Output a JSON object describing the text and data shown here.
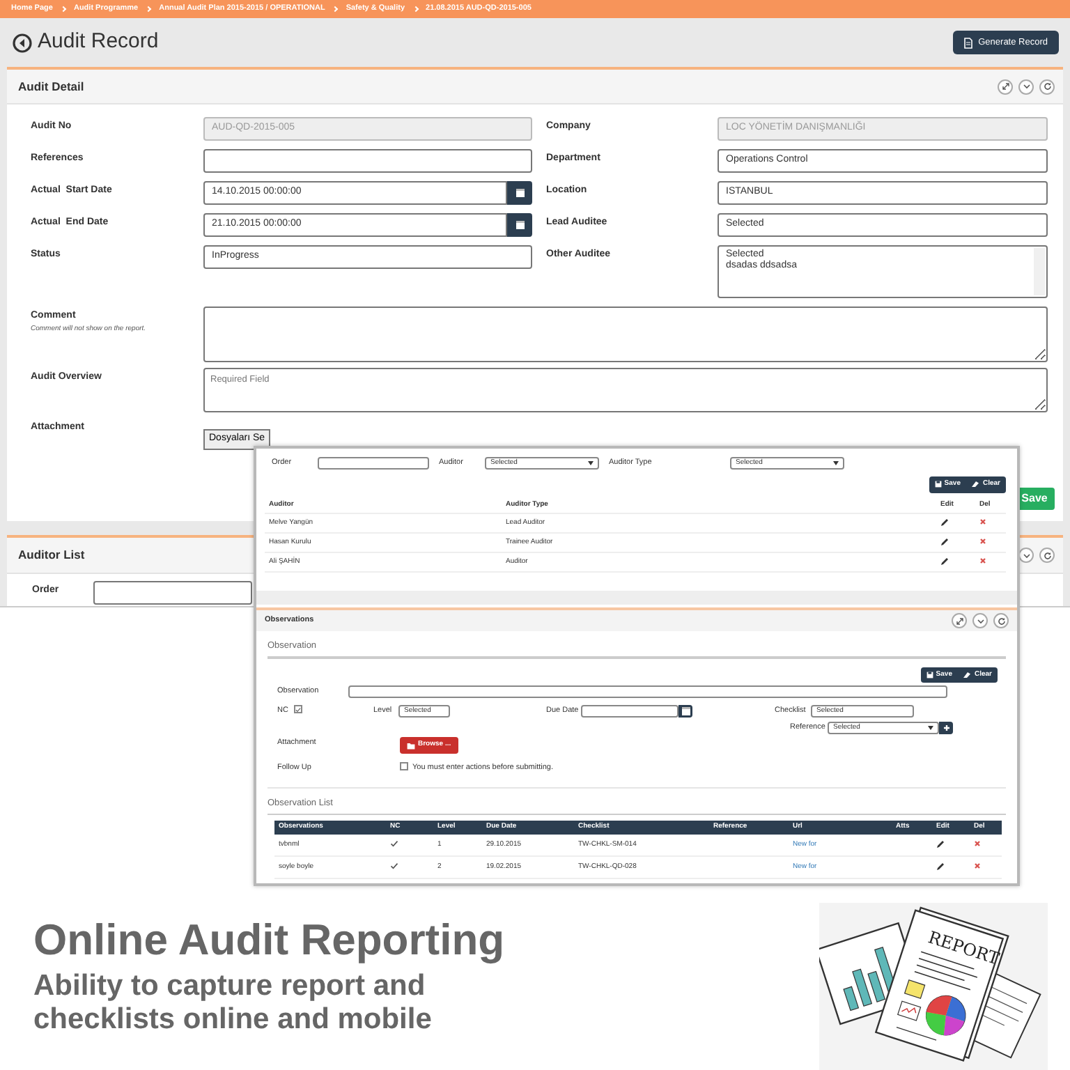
{
  "breadcrumb": [
    "Home Page",
    "Audit Programme",
    "Annual Audit Plan 2015-2015 / OPERATIONAL",
    "Safety & Quality",
    "21.08.2015 AUD-QD-2015-005"
  ],
  "header": {
    "title": "Audit Record",
    "button": "Generate Record"
  },
  "audit_detail": {
    "title": "Audit Detail",
    "rows": [
      [
        {
          "label": "Audit No",
          "kind": "text",
          "value": "AUD-QD-2015-005",
          "disabled": true
        },
        {
          "label": "Company",
          "kind": "text",
          "value": "LOC YÖNETİM DANIŞMANLIĞI",
          "disabled": true
        }
      ],
      [
        {
          "label": "References",
          "kind": "text",
          "disabled": false
        },
        {
          "label": "Department",
          "kind": "text",
          "value": "Operations Control",
          "disabled": false
        }
      ],
      [
        {
          "label": "Actual  Start Date",
          "kind": "date",
          "value": "14.10.2015 00:00:00",
          "disabled": false
        },
        {
          "label": "Location",
          "kind": "text",
          "value": "ISTANBUL",
          "disabled": false
        }
      ],
      [
        {
          "label": "Actual  End Date",
          "kind": "date",
          "value": "21.10.2015 00:00:00",
          "disabled": false
        },
        {
          "label": "Lead Auditee",
          "kind": "text",
          "value": "Selected",
          "disabled": false
        }
      ],
      [
        {
          "label": "Status",
          "kind": "text",
          "value": "InProgress",
          "disabled": false
        },
        {
          "label": "Other Auditee",
          "kind": "multi",
          "options": [
            "Selected",
            "dsadas ddsadsa"
          ],
          "disabled": false
        }
      ]
    ],
    "wide": [
      {
        "label": "Comment",
        "hint": "Comment will not show on the report.",
        "kind": "textarea"
      },
      {
        "label": "Audit Overview",
        "kind": "textarea",
        "placeholder": "Required Field"
      },
      {
        "label": "Attachment",
        "kind": "file",
        "button": "Dosyaları Se"
      }
    ],
    "save_button": "Save"
  },
  "auditor_list": {
    "title": "Auditor List",
    "field_label": "Order"
  },
  "auditor_form": {
    "fields": [
      {
        "label": "Order",
        "kind": "text"
      },
      {
        "label": "Auditor",
        "kind": "select",
        "value": "Selected"
      },
      {
        "label": "Auditor Type",
        "kind": "select",
        "value": "Selected"
      }
    ],
    "buttons": [
      "Save",
      "Clear"
    ],
    "columns": [
      "Auditor",
      "Auditor Type",
      "Edit",
      "Del"
    ],
    "rows": [
      {
        "auditor": "Melve Yangün",
        "type": "Lead Auditor"
      },
      {
        "auditor": "Hasan Kurulu",
        "type": "Trainee Auditor"
      },
      {
        "auditor": "Ali ŞAHİN",
        "type": "Auditor"
      }
    ]
  },
  "observations": {
    "title": "Observations",
    "section": "Observation",
    "buttons": [
      "Save",
      "Clear"
    ],
    "observation_label": "Observation",
    "nc": {
      "label": "NC",
      "checked": true
    },
    "level": {
      "label": "Level",
      "value": "Selected"
    },
    "due_date": {
      "label": "Due Date"
    },
    "checklist": {
      "label": "Checklist",
      "value": "Selected"
    },
    "reference": {
      "label": "Reference",
      "value": "Selected"
    },
    "attachment": {
      "label": "Attachment",
      "button": "Browse ..."
    },
    "follow_up": {
      "label": "Follow Up",
      "checked": false,
      "text": "You must enter actions before submitting."
    },
    "list_title": "Observation List",
    "columns": [
      "Observations",
      "NC",
      "Level",
      "Due Date",
      "Checklist",
      "Reference",
      "Url",
      "Atts",
      "Edit",
      "Del"
    ],
    "rows": [
      {
        "observation": "tvbnml",
        "nc": true,
        "level": "1",
        "due_date": "29.10.2015",
        "checklist": "TW-CHKL-SM-014",
        "url": "New for"
      },
      {
        "observation": "soyle boyle",
        "nc": true,
        "level": "2",
        "due_date": "19.02.2015",
        "checklist": "TW-CHKL-QD-028",
        "url": "New for"
      }
    ]
  },
  "promo": {
    "title": "Online Audit Reporting",
    "subtitle": "Ability to capture report and checklists online and mobile",
    "illustration_text": "REPORT"
  }
}
